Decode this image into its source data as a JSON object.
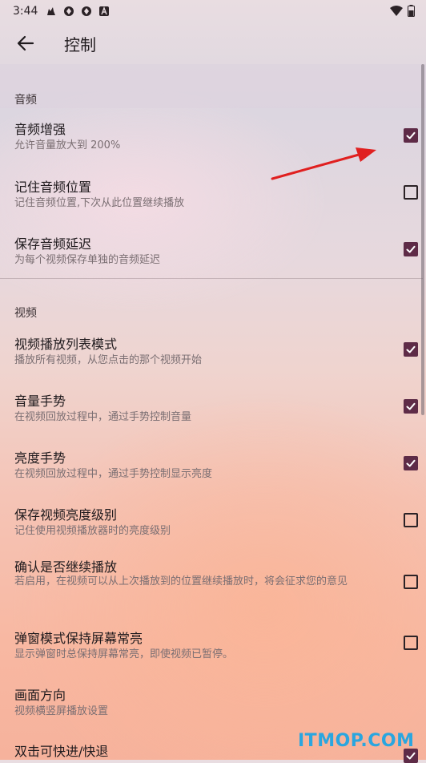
{
  "status": {
    "time": "3:44",
    "notification_icons": [
      "cat-icon",
      "sync-icon",
      "sync-icon",
      "a-icon"
    ],
    "right_icons": [
      "wifi-icon",
      "battery-icon"
    ]
  },
  "appbar": {
    "title": "控制"
  },
  "sections": [
    {
      "header": "音频",
      "items": [
        {
          "title": "音频增强",
          "subtitle": "允许音量放大到 200%",
          "checked": true
        },
        {
          "title": "记住音频位置",
          "subtitle": "记住音频位置,下次从此位置继续播放",
          "checked": false
        },
        {
          "title": "保存音频延迟",
          "subtitle": "为每个视频保存单独的音频延迟",
          "checked": true
        }
      ]
    },
    {
      "header": "视频",
      "items": [
        {
          "title": "视频播放列表模式",
          "subtitle": "播放所有视频，从您点击的那个视频开始",
          "checked": true
        },
        {
          "title": "音量手势",
          "subtitle": "在视频回放过程中，通过手势控制音量",
          "checked": true
        },
        {
          "title": "亮度手势",
          "subtitle": "在视频回放过程中，通过手势控制显示亮度",
          "checked": true
        },
        {
          "title": "保存视频亮度级别",
          "subtitle": "记住使用视频播放器时的亮度级别",
          "checked": false
        },
        {
          "title": "确认是否继续播放",
          "subtitle": "若启用，在视频可以从上次播放到的位置继续播放时，将会征求您的意见",
          "checked": false
        },
        {
          "title": "弹窗模式保持屏幕常亮",
          "subtitle": "显示弹窗时总保持屏幕常亮，即使视频已暂停。",
          "checked": false
        },
        {
          "title": "画面方向",
          "subtitle": "视频横竖屏播放设置",
          "checked": null
        },
        {
          "title": "双击可快进/快退",
          "subtitle": "",
          "checked": true
        }
      ]
    }
  ],
  "watermark": "ITMOP.COM",
  "colors": {
    "accent": "#5e2b47",
    "arrow": "#e02020",
    "watermark": "#2aa6df"
  }
}
